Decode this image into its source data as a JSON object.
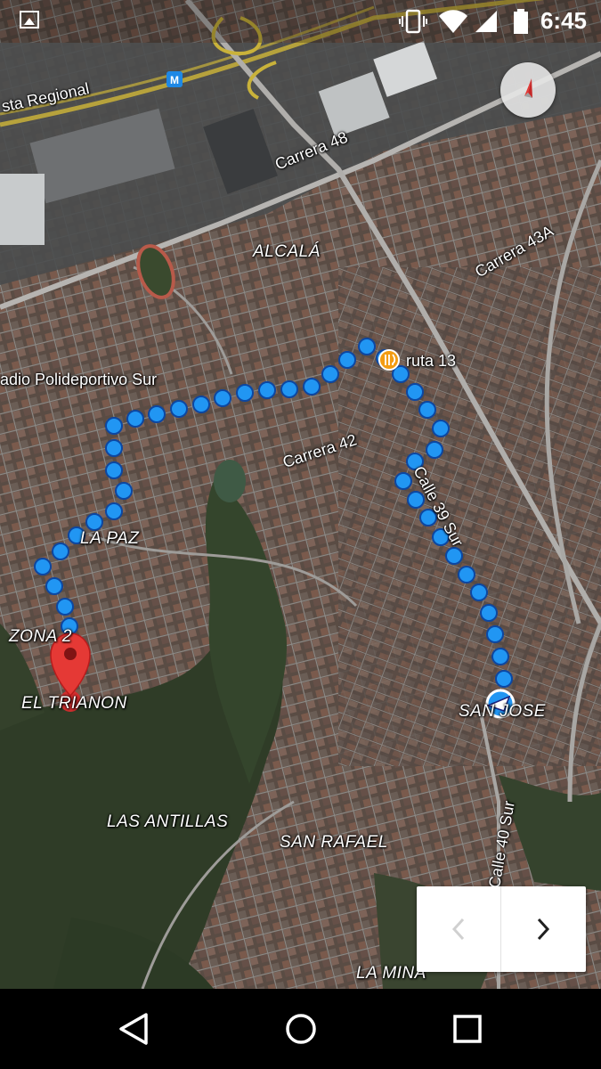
{
  "status_bar": {
    "time": "6:45",
    "icons": [
      "gallery-icon",
      "vibrate-icon",
      "wifi-icon",
      "signal-icon",
      "battery-icon"
    ]
  },
  "map": {
    "compass_icon": "compass-icon",
    "labels": {
      "autopista": "sta Regional",
      "carrera48": "Carrera 48",
      "alcala": "ALCALÁ",
      "carrera43a": "Carrera 43A",
      "estadio": "adio Polideportivo Sur",
      "ruta13": "ruta 13",
      "carrera42": "Carrera 42",
      "calle39": "Calle 39 Sur",
      "lapaz": "LA PAZ",
      "zona": "ZONA 2",
      "eltrianon": "EL TRIANON",
      "sanjose": "SAN JOSE",
      "lasantillas": "LAS ANTILLAS",
      "sanrafael": "SAN RAFAEL",
      "calle40": "Calle 40 Sur",
      "lamina": "LA MINA"
    },
    "metro_icon_label": "M",
    "route_color": "#2196f3",
    "destination_pin_color": "#e53935"
  },
  "step_control": {
    "prev_icon": "chevron-left-icon",
    "next_icon": "chevron-right-icon"
  },
  "nav_bar": {
    "back_icon": "back-icon",
    "home_icon": "home-icon",
    "recents_icon": "recents-icon"
  }
}
